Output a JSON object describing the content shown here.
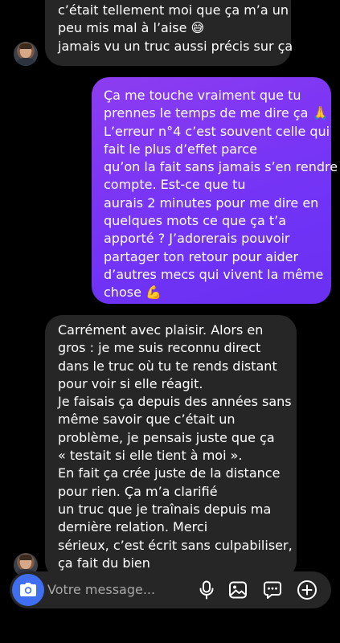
{
  "messages": [
    {
      "id": "msg-1",
      "direction": "incoming",
      "lines": [
        "c’était tellement moi que ça m’a un",
        "peu mis mal à l’aise 😅",
        "jamais vu un truc aussi précis sur ça"
      ]
    },
    {
      "id": "msg-2",
      "direction": "outgoing",
      "lines": [
        "Ça me touche vraiment que tu",
        "prennes le temps de me dire ça 🙏",
        "L’erreur n°4 c’est souvent celle qui",
        "fait le plus d’effet parce",
        "qu’on la fait sans jamais s’en rendre",
        "compte. Est-ce que tu",
        "aurais 2 minutes pour me dire en",
        "quelques mots ce que ça t’a",
        "apporté ? J’adorerais pouvoir",
        "partager ton retour pour aider",
        "d’autres mecs qui vivent la même",
        "chose 💪"
      ]
    },
    {
      "id": "msg-3",
      "direction": "incoming",
      "lines": [
        "Carrément avec plaisir. Alors en",
        "gros : je me suis reconnu direct",
        "dans le truc où tu te rends distant",
        "pour voir si elle réagit.",
        "Je faisais ça depuis des années sans",
        "même savoir que c’était un",
        "problème, je pensais juste que ça",
        "« testait si elle tient à moi ».",
        "En fait ça crée juste de la distance",
        "pour rien. Ça m’a clarifié",
        "un truc que je traînais depuis ma",
        "dernière relation. Merci",
        "sérieux, c’est écrit sans culpabiliser,",
        "ça fait du bien"
      ]
    }
  ],
  "composer": {
    "placeholder": "Votre message...",
    "camera_icon": "camera-icon",
    "mic_icon": "microphone-icon",
    "gallery_icon": "gallery-icon",
    "sticker_icon": "sticker-icon",
    "plus_icon": "plus-icon"
  },
  "colors": {
    "background": "#000000",
    "incoming_bubble": "#262626",
    "outgoing_bubble_start": "#8d3df0",
    "outgoing_bubble_end": "#6b2ff2",
    "camera_button": "#3f6ef0",
    "placeholder_text": "#a8a8a8"
  }
}
